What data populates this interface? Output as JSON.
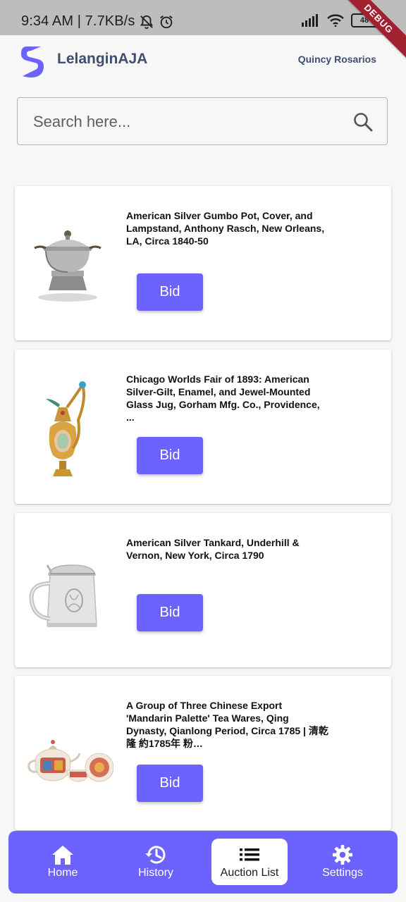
{
  "status_bar": {
    "time_speed": "9:34 AM | 7.7KB/s",
    "battery": "48",
    "debug_label": "DEBUG"
  },
  "app": {
    "brand": "LelanginAJA",
    "user": "Quincy Rosarios"
  },
  "search": {
    "placeholder": "Search here...",
    "value": ""
  },
  "items": [
    {
      "title": "American Silver Gumbo Pot, Cover, and Lampstand, Anthony Rasch, New Orleans, LA, Circa 1840-50",
      "bid_label": "Bid"
    },
    {
      "title": "Chicago Worlds Fair of 1893: American Silver-Gilt, Enamel, and Jewel-Mounted Glass Jug, Gorham Mfg. Co., Providence, ...",
      "bid_label": "Bid"
    },
    {
      "title": "American Silver Tankard, Underhill & Vernon, New York, Circa 1790",
      "bid_label": "Bid"
    },
    {
      "title": "A Group of Three Chinese Export 'Mandarin Palette' Tea Wares, Qing Dynasty, Qianlong Period, Circa 1785 | 清乾隆 約1785年 粉…",
      "bid_label": "Bid"
    }
  ],
  "nav": {
    "active": "Auction List",
    "items": [
      {
        "label": "Home",
        "icon": "home-icon"
      },
      {
        "label": "History",
        "icon": "history-icon"
      },
      {
        "label": "Auction List",
        "icon": "list-icon"
      },
      {
        "label": "Settings",
        "icon": "gear-icon"
      }
    ]
  },
  "colors": {
    "accent": "#6c63ff",
    "brand_text": "#3f4e6e",
    "debug_banner": "#a3202e"
  }
}
